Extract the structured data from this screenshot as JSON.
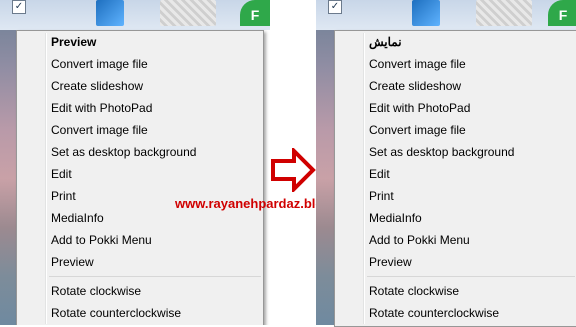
{
  "left_menu": {
    "items": [
      {
        "label": "Preview",
        "bold": true
      },
      {
        "label": "Convert image file"
      },
      {
        "label": "Create slideshow"
      },
      {
        "label": "Edit with PhotoPad"
      },
      {
        "label": "Convert image file"
      },
      {
        "label": "Set as desktop background"
      },
      {
        "label": "Edit"
      },
      {
        "label": "Print"
      },
      {
        "label": "MediaInfo"
      },
      {
        "label": "Add to Pokki Menu"
      },
      {
        "label": "Preview"
      }
    ],
    "after_separator": [
      {
        "label": "Rotate clockwise"
      },
      {
        "label": "Rotate counterclockwise"
      }
    ]
  },
  "right_menu": {
    "items": [
      {
        "label": "نمایش",
        "bold": true
      },
      {
        "label": "Convert image file"
      },
      {
        "label": "Create slideshow"
      },
      {
        "label": "Edit with PhotoPad"
      },
      {
        "label": "Convert image file"
      },
      {
        "label": "Set as desktop background"
      },
      {
        "label": "Edit"
      },
      {
        "label": "Print"
      },
      {
        "label": "MediaInfo"
      },
      {
        "label": "Add to Pokki Menu"
      },
      {
        "label": "Preview"
      }
    ],
    "after_separator": [
      {
        "label": "Rotate clockwise"
      },
      {
        "label": "Rotate counterclockwise"
      }
    ]
  },
  "watermark": "www.rayanehpardaz.blog.ir",
  "colors": {
    "arrow": "#d00000",
    "watermark": "#d00000",
    "menu_bg": "#f0f0f0"
  },
  "icons": {
    "arrow": "right-arrow-icon",
    "checkbox": "checkbox-checked-icon"
  }
}
